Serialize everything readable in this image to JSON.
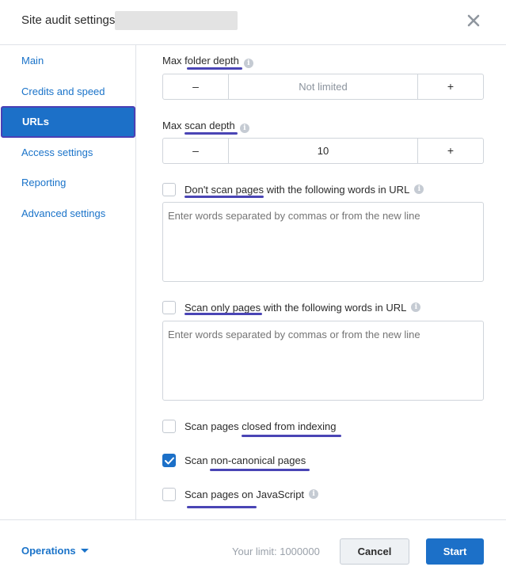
{
  "header": {
    "title": "Site audit settings",
    "close_icon": "close-icon"
  },
  "sidebar": {
    "items": [
      {
        "label": "Main",
        "active": false
      },
      {
        "label": "Credits and speed",
        "active": false
      },
      {
        "label": "URLs",
        "active": true
      },
      {
        "label": "Access settings",
        "active": false
      },
      {
        "label": "Reporting",
        "active": false
      },
      {
        "label": "Advanced settings",
        "active": false
      }
    ]
  },
  "urls": {
    "max_folder_depth": {
      "label": "Max folder depth",
      "minus": "–",
      "value": "Not limited",
      "plus": "+"
    },
    "max_scan_depth": {
      "label": "Max scan depth",
      "minus": "–",
      "value": "10",
      "plus": "+"
    },
    "dont_scan": {
      "label": "Don't scan pages with the following words in URL",
      "checked": false,
      "placeholder": "Enter words separated by commas or from the new line"
    },
    "scan_only": {
      "label": "Scan only pages with the following words in URL",
      "checked": false,
      "placeholder": "Enter words separated by commas or from the new line"
    },
    "closed_from_indexing": {
      "label": "Scan pages closed from indexing",
      "checked": false
    },
    "non_canonical": {
      "label": "Scan non-canonical pages",
      "checked": true
    },
    "javascript": {
      "label": "Scan pages on JavaScript",
      "checked": false
    },
    "info_glyph": "i"
  },
  "footer": {
    "operations": "Operations",
    "limit": "Your limit: 1000000",
    "cancel": "Cancel",
    "start": "Start"
  },
  "colors": {
    "accent": "#1c70c8",
    "underline": "#4a45b5",
    "link": "#1a73c9"
  }
}
